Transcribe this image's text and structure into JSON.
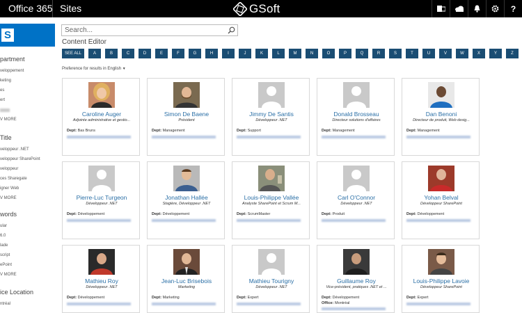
{
  "topbar": {
    "office365": "Office 365",
    "sites": "Sites",
    "brand": "GSoft",
    "icons": [
      "outlook-icon",
      "onedrive-icon",
      "bell-icon",
      "gear-icon",
      "help-icon"
    ],
    "help_glyph": "?"
  },
  "sharepoint_logo_letter": "S",
  "sidebar": {
    "sections": [
      {
        "heading": "partment",
        "items": [
          "veloppement",
          "keting",
          "es",
          "ert",
          "",
          "V MORE"
        ]
      },
      {
        "heading": "Title",
        "items": [
          "veloppeur .NET",
          "veloppeur SharePoint",
          "veloppeur",
          "ces Sharegate",
          "igner Web",
          "V MORE"
        ]
      },
      {
        "heading": "words",
        "items": [
          "ular",
          "6.0",
          "lade",
          "script",
          "ePoint",
          "V MORE"
        ]
      },
      {
        "heading": "ice Location",
        "items": [
          "ntréal"
        ]
      }
    ]
  },
  "search": {
    "placeholder": "Search..."
  },
  "content_title": "Content Editor",
  "alphabet": [
    "SEE ALL",
    "A",
    "B",
    "C",
    "D",
    "E",
    "F",
    "G",
    "H",
    "I",
    "J",
    "K",
    "L",
    "M",
    "N",
    "O",
    "P",
    "Q",
    "R",
    "S",
    "T",
    "U",
    "V",
    "W",
    "X",
    "Y",
    "Z"
  ],
  "preference": "Preference for results in English",
  "people": [
    {
      "name": "Caroline Auger",
      "title": "Adjointe administrative et gestio...",
      "dept_label": "Dept:",
      "dept": "Bas Bruns",
      "photo": "woman-blonde"
    },
    {
      "name": "Simon De Baene",
      "title": "Président",
      "dept_label": "Dept:",
      "dept": "Management",
      "photo": "man-beard"
    },
    {
      "name": "Jimmy De Santis",
      "title": "Développeur .NET",
      "dept_label": "Dept:",
      "dept": "Support",
      "photo": "placeholder"
    },
    {
      "name": "Donald Brosseau",
      "title": "Directeur solutions d'affaires",
      "dept_label": "Dept:",
      "dept": "Management",
      "photo": "placeholder"
    },
    {
      "name": "Dan Benoni",
      "title": "Directeur de produit, Web desig...",
      "dept_label": "Dept:",
      "dept": "Management",
      "photo": "man-blue"
    },
    {
      "name": "Pierre-Luc Turgeon",
      "title": "Développeur .NET",
      "dept_label": "Dept:",
      "dept": "Développement",
      "photo": "placeholder"
    },
    {
      "name": "Jonathan Hallée",
      "title": "Stagière, Développeur .NET",
      "dept_label": "Dept:",
      "dept": "Développement",
      "photo": "man-plaid"
    },
    {
      "name": "Louis-Philippe Vallée",
      "title": "Analyste SharePoint et Scrum M...",
      "dept_label": "Dept:",
      "dept": "ScrumMaster",
      "photo": "man-outdoor"
    },
    {
      "name": "Carl O'Connor",
      "title": "Développeur .NET",
      "dept_label": "Dept:",
      "dept": "Produit",
      "photo": "placeholder"
    },
    {
      "name": "Yohan Belval",
      "title": "Développeur SharePoint",
      "dept_label": "Dept:",
      "dept": "Développement",
      "photo": "man-red"
    },
    {
      "name": "Mathieu Roy",
      "title": "Développeur .NET",
      "dept_label": "Dept:",
      "dept": "Développement",
      "photo": "man-redshirt"
    },
    {
      "name": "Jean-Luc Brisebois",
      "title": "Marketing",
      "dept_label": "Dept:",
      "dept": "Marketing",
      "photo": "man-suit"
    },
    {
      "name": "Mathieu Tourigny",
      "title": "Développeur .NET",
      "dept_label": "Dept:",
      "dept": "Expert",
      "photo": "placeholder"
    },
    {
      "name": "Guillaume Roy",
      "title": "Vice-président, pratiques .NET et ...",
      "dept_label": "Dept:",
      "dept": "Développement",
      "office_label": "Office:",
      "office": "Montréal",
      "photo": "man-dark"
    },
    {
      "name": "Louis-Philippe Lavoie",
      "title": "Développeur SharePoint",
      "dept_label": "Dept:",
      "dept": "Expert",
      "photo": "man-smile"
    }
  ],
  "colors": {
    "topbar": "#000000",
    "sharepoint_blue": "#0072c6",
    "alpha_button": "#1a4d73",
    "name_link": "#2a6fa6"
  }
}
